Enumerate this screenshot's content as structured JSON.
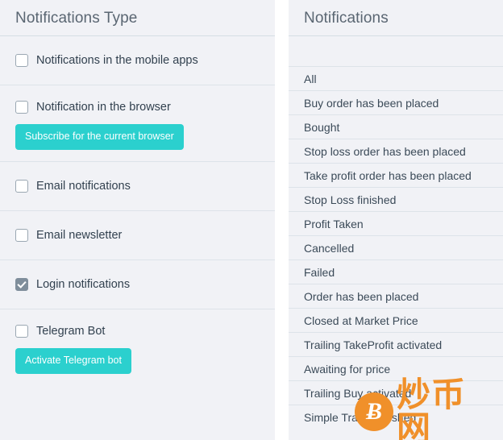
{
  "left_panel": {
    "title": "Notifications Type",
    "options": [
      {
        "label": "Notifications in the mobile apps",
        "checked": false,
        "button": null
      },
      {
        "label": "Notification in the browser",
        "checked": false,
        "button": "Subscribe for the current browser"
      },
      {
        "label": "Email notifications",
        "checked": false,
        "button": null
      },
      {
        "label": "Email newsletter",
        "checked": false,
        "button": null
      },
      {
        "label": "Login notifications",
        "checked": true,
        "button": null
      },
      {
        "label": "Telegram Bot",
        "checked": false,
        "button": "Activate Telegram bot"
      }
    ]
  },
  "right_panel": {
    "title": "Notifications",
    "items": [
      "All",
      "Buy order has been placed",
      "Bought",
      "Stop loss order has been placed",
      "Take profit order has been placed",
      "Stop Loss finished",
      "Profit Taken",
      "Cancelled",
      "Failed",
      "Order has been placed",
      "Closed at Market Price",
      "Trailing TakeProfit activated",
      "Awaiting for price",
      "Trailing Buy activated",
      "Simple Trade Finished"
    ]
  },
  "watermark": {
    "coin_glyph": "Ƀ",
    "text": "炒币网"
  },
  "colors": {
    "panel_background": "#f1f2f6",
    "accent_teal": "#2bd0ce",
    "checkbox_checked": "#7f8e9b",
    "divider": "#dde3e9",
    "watermark_orange": "#f0902a"
  }
}
